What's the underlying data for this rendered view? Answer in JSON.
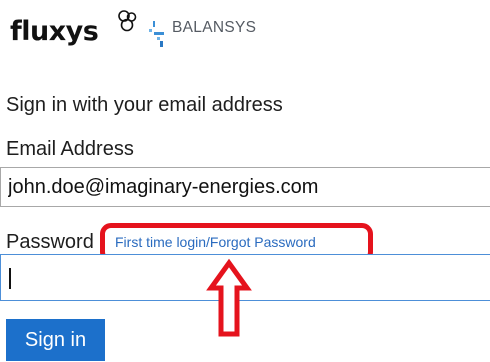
{
  "logos": {
    "fluxys": "fluxys",
    "balansys": "BALANSYS"
  },
  "form": {
    "heading": "Sign in with your email address",
    "email_label": "Email Address",
    "email_value": "john.doe@imaginary-energies.com",
    "password_label": "Password",
    "forgot_link": "First time login/Forgot Password",
    "password_value": "",
    "submit_label": "Sign in"
  },
  "annotation": {
    "color": "#e5131d"
  },
  "colors": {
    "button": "#1c70cb",
    "link": "#2a6bbf"
  }
}
